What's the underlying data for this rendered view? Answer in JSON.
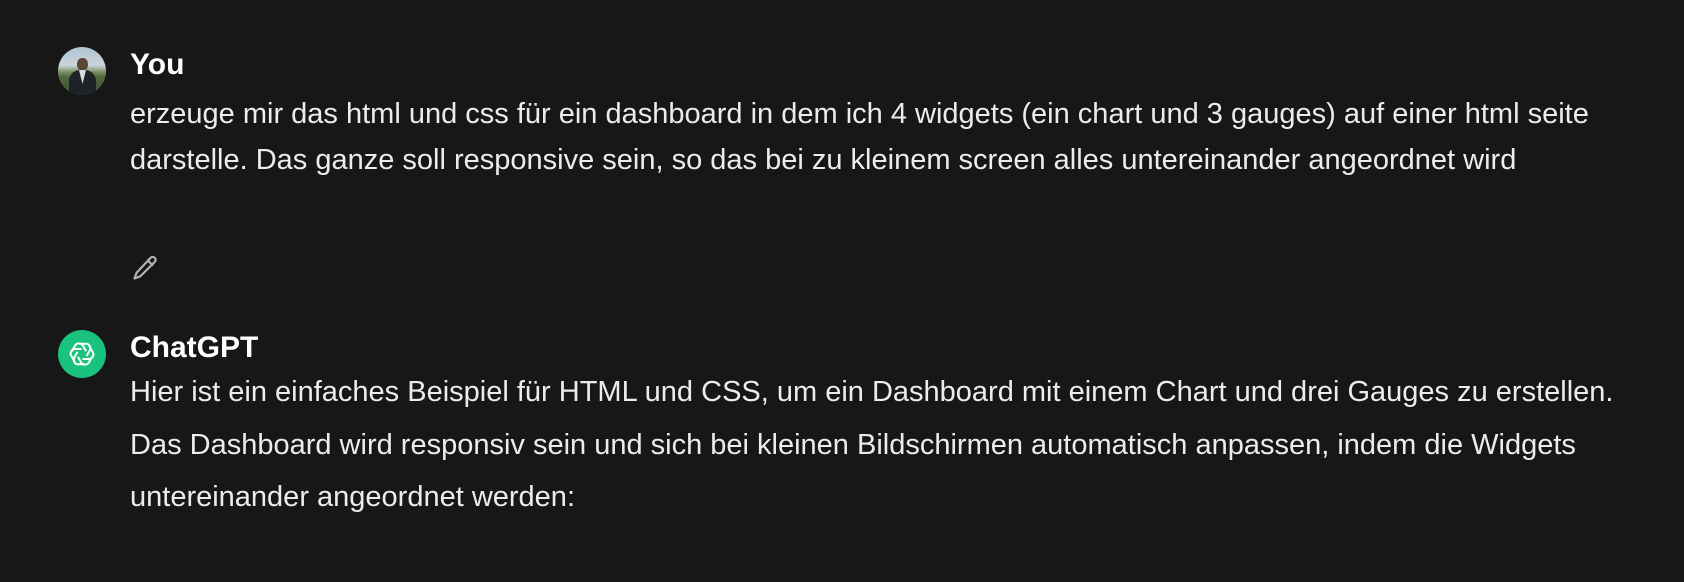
{
  "conversation": {
    "user": {
      "author": "You",
      "text": "erzeuge mir das html und css für ein dashboard in dem ich 4 widgets (ein chart und 3 gauges) auf einer html seite darstelle. Das ganze soll responsive sein, so das bei zu kleinem screen alles untereinander angeordnet wird",
      "avatar_icon": "user-photo-avatar",
      "edit_icon": "pencil-icon"
    },
    "assistant": {
      "author": "ChatGPT",
      "text": "Hier ist ein einfaches Beispiel für HTML und CSS, um ein Dashboard mit einem Chart und drei Gauges zu erstellen. Das Dashboard wird responsiv sein und sich bei kleinen Bildschirmen automatisch anpassen, indem die Widgets untereinander angeordnet werden:",
      "avatar_icon": "openai-logo-icon",
      "avatar_color": "#19c37d"
    }
  },
  "colors": {
    "background": "#171717",
    "text": "#ececec",
    "author": "#ffffff",
    "icon": "#b4b4b4"
  }
}
